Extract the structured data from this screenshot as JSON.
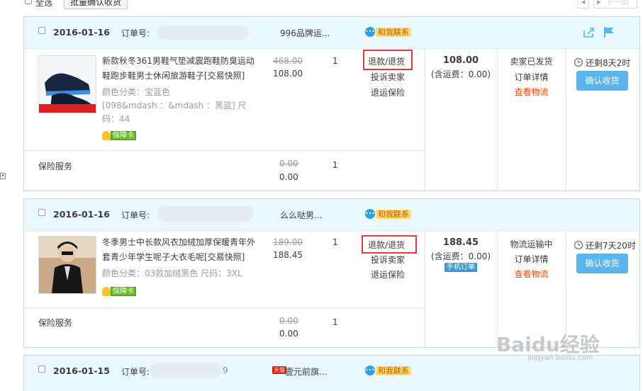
{
  "top": {
    "select_all": "全选",
    "batch_confirm": "批量确认收货",
    "next_page": "下一页"
  },
  "orders": [
    {
      "date": "2016-01-16",
      "order_no_label": "订单号:",
      "shop": "996品牌运...",
      "contact": "和我联系",
      "item": {
        "title": "新款秋冬361男鞋气垫减震跑鞋防臭运动鞋跑步鞋男士休闲旅游鞋子[交易快照]",
        "title_l1": "新款秋冬361男鞋气垫减震跑鞋防臭运动",
        "title_l2": "鞋跑步鞋男士休闲旅游鞋子[交易快照]",
        "attr_l1": "颜色分类：宝蓝色",
        "attr_l2": "[098&mdash ：&mdash ：黑蓝] 尺",
        "attr_l3": "码：44",
        "badge": "保障卡",
        "orig_price": "468.00",
        "price": "108.00",
        "qty": "1"
      },
      "actions": {
        "refund": "退款/退货",
        "complain": "投诉卖家",
        "insurance": "退运保险"
      },
      "total": "108.00",
      "shipping": "(含运费：0.00)",
      "mobile_tag": "",
      "status": "卖家已发货",
      "detail": "订单详情",
      "logistics": "查看物流",
      "countdown": "还剩8天2时",
      "confirm": "确认收货",
      "service": {
        "label": "保险服务",
        "orig_price": "0.00",
        "price": "0.00",
        "qty": "1"
      }
    },
    {
      "date": "2016-01-16",
      "order_no_label": "订单号:",
      "shop": "么么哒男...",
      "contact": "和我联系",
      "item": {
        "title": "冬季男士中长款风衣加绒加厚保暖青年外套青少年学生呢子大衣毛呢[交易快照]",
        "title_l1": "冬季男士中长款风衣加绒加厚保暖青年外",
        "title_l2": "套青少年学生呢子大衣毛呢[交易快照]",
        "attr_l1": "颜色分类：03款加绒黑色  尺码：3XL",
        "attr_l2": "",
        "attr_l3": "",
        "badge": "保障卡",
        "orig_price": "189.00",
        "price": "188.45",
        "qty": "1"
      },
      "actions": {
        "refund": "退款/退货",
        "complain": "投诉卖家",
        "insurance": "退运保险"
      },
      "total": "188.45",
      "shipping": "(含运费：0.00)",
      "mobile_tag": "手机订单",
      "status": "物流运输中",
      "detail": "订单详情",
      "logistics": "查看物流",
      "countdown": "还剩7天20时",
      "confirm": "确认收货",
      "service": {
        "label": "保险服务",
        "orig_price": "0.00",
        "price": "0.00",
        "qty": "1"
      }
    },
    {
      "date": "2016-01-15",
      "order_no_label": "订单号:",
      "order_no_tail": "9",
      "shop_tag": "天猫",
      "shop": "壹元前旗...",
      "contact": "和我联系"
    }
  ],
  "watermark": {
    "brand": "Baidu经验",
    "url": "jingyan.baidu.com"
  },
  "colors": {
    "header_bg": "#eaf8ff",
    "border": "#bcd9ee",
    "accent_orange": "#f40",
    "button_blue": "#5ab4ee",
    "highlight_red": "#e4393c"
  },
  "icons": [
    "share-icon",
    "flag-icon",
    "clock-icon",
    "contact-bubble-icon",
    "shield-icon",
    "dropdown-arrow-icon"
  ]
}
